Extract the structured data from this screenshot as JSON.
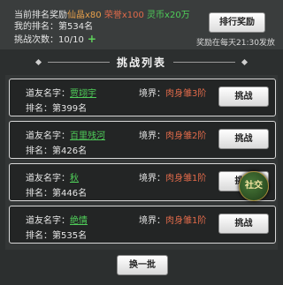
{
  "header": {
    "reward_prefix": "当前排名奖励",
    "rewards": [
      {
        "name": "仙晶",
        "amount": "x80",
        "color": "#e7a04b"
      },
      {
        "name": "荣誉",
        "amount": "x100",
        "color": "#e06a4a"
      },
      {
        "name": "灵币",
        "amount": "x20万",
        "color": "#4fce59"
      }
    ],
    "my_rank_label": "我的排名：",
    "my_rank_value": "第534名",
    "attempts_label": "挑战次数：",
    "attempts_value": "10/10",
    "add_attempts_icon": "plus-icon",
    "ranking_reward_button": "排行奖励",
    "reward_time_note": "奖励在每天21:30发放"
  },
  "section": {
    "title": "挑战列表"
  },
  "opponents": [
    {
      "name_label": "道友名字：",
      "name": "贾翊宇",
      "realm_label": "境界：",
      "realm": "肉身雏3阶",
      "rank_label": "排名：",
      "rank": "第399名",
      "button": "挑战"
    },
    {
      "name_label": "道友名字：",
      "name": "百里残河",
      "realm_label": "境界：",
      "realm": "肉身雏2阶",
      "rank_label": "排名：",
      "rank": "第426名",
      "button": "挑战"
    },
    {
      "name_label": "道友名字：",
      "name": "秋",
      "realm_label": "境界：",
      "realm": "肉身雏1阶",
      "rank_label": "排名：",
      "rank": "第446名",
      "button": "挑战"
    },
    {
      "name_label": "道友名字：",
      "name": "绝情",
      "realm_label": "境界：",
      "realm": "肉身雏1阶",
      "rank_label": "排名：",
      "rank": "第535名",
      "button": "挑战"
    }
  ],
  "social_button": "社交",
  "refresh_button": "换一批"
}
